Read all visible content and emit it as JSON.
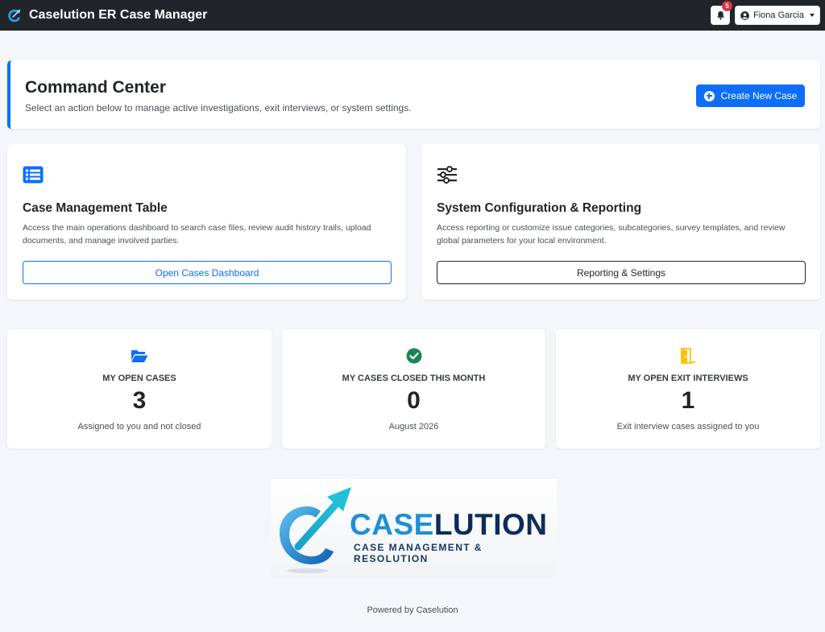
{
  "app": {
    "title": "Caselution ER Case Manager",
    "notification_count": "5",
    "user_name": "Fiona Garcia"
  },
  "command_center": {
    "title": "Command Center",
    "subtitle": "Select an action below to manage active investigations, exit interviews, or system settings.",
    "create_button": "Create New Case"
  },
  "actions": [
    {
      "icon": "list-icon",
      "title": "Case Management Table",
      "description": "Access the main operations dashboard to search case files, review audit history trails, upload documents, and manage involved parties.",
      "button": "Open Cases Dashboard"
    },
    {
      "icon": "sliders-icon",
      "title": "System Configuration & Reporting",
      "description": "Access reporting or customize issue categories, subcategories, survey templates, and review global parameters for your local environment.",
      "button": "Reporting & Settings"
    }
  ],
  "stats": [
    {
      "icon": "folder-open-icon",
      "label": "MY OPEN CASES",
      "value": "3",
      "footnote": "Assigned to you and not closed"
    },
    {
      "icon": "check-circle-icon",
      "label": "MY CASES CLOSED THIS MONTH",
      "value": "0",
      "footnote": "August 2026"
    },
    {
      "icon": "door-open-icon",
      "label": "MY OPEN EXIT INTERVIEWS",
      "value": "1",
      "footnote": "Exit interview cases assigned to you"
    }
  ],
  "logo": {
    "word_part1": "CASE",
    "word_part2": "LUTION",
    "tagline": "CASE MANAGEMENT & RESOLUTION"
  },
  "footer": {
    "text": "Powered by Caselution"
  },
  "colors": {
    "navbar": "#212529",
    "primary": "#0d6efd",
    "success": "#198754",
    "warning": "#ffc107",
    "badge": "#dc3545"
  }
}
